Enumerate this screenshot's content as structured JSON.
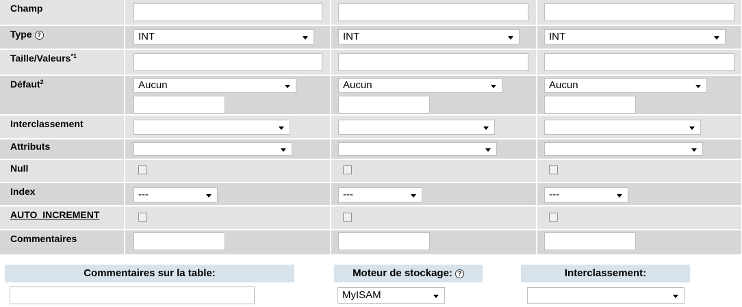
{
  "rows": {
    "champ": "Champ",
    "type": "Type",
    "taille": "Taille/Valeurs",
    "taille_sup": "*1",
    "defaut": "Défaut",
    "defaut_sup": "2",
    "interclassement": "Interclassement",
    "attributs": "Attributs",
    "null": "Null",
    "index": "Index",
    "auto_increment": "AUTO_INCREMENT",
    "commentaires": "Commentaires"
  },
  "help_glyph": "?",
  "columns": [
    {
      "type_value": "INT",
      "default_value": "Aucun",
      "index_value": "---"
    },
    {
      "type_value": "INT",
      "default_value": "Aucun",
      "index_value": "---"
    },
    {
      "type_value": "INT",
      "default_value": "Aucun",
      "index_value": "---"
    }
  ],
  "bottom": {
    "table_comments_label": "Commentaires sur la table:",
    "storage_engine_label": "Moteur de stockage:",
    "storage_engine_value": "MyISAM",
    "collation_label": "Interclassement:"
  },
  "colors": {
    "row_even": "#e3e3e3",
    "row_odd": "#d6d6d6",
    "header_blue": "#d8e2ea"
  }
}
